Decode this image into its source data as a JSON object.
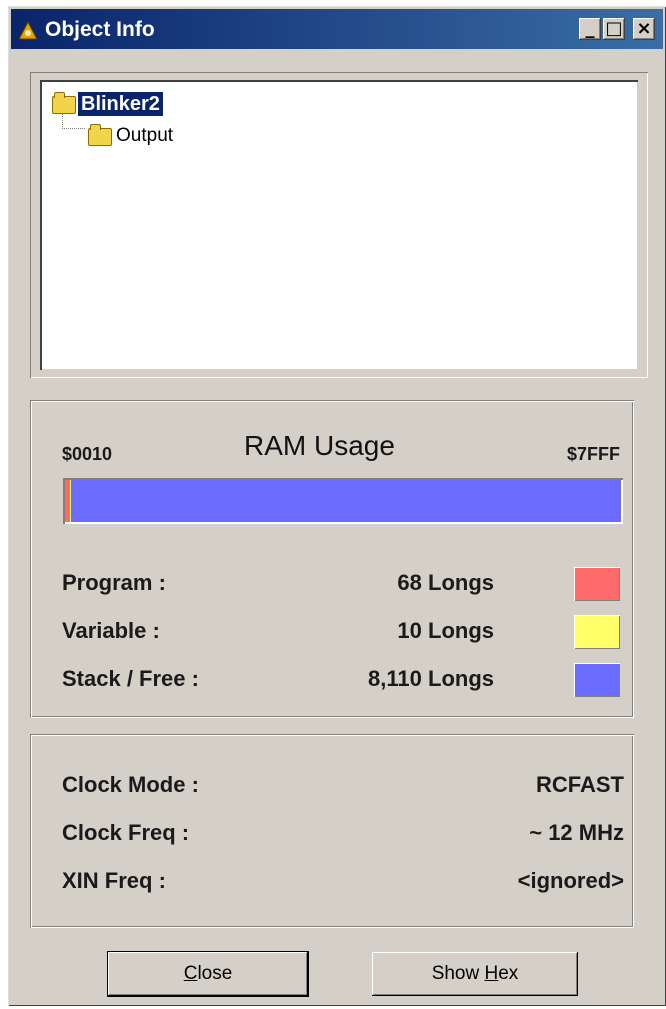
{
  "window": {
    "title": "Object Info",
    "controls": {
      "minimize": "_",
      "maximize": "□",
      "close": "×"
    }
  },
  "tree": {
    "root": "Blinker2",
    "child": "Output"
  },
  "ram": {
    "title": "RAM Usage",
    "start_addr": "$0010",
    "end_addr": "$7FFF",
    "rows": [
      {
        "label": "Program :",
        "value": "68 Longs",
        "color": "#ff6b6b"
      },
      {
        "label": "Variable :",
        "value": "10 Longs",
        "color": "#ffff66"
      },
      {
        "label": "Stack / Free :",
        "value": "8,110 Longs",
        "color": "#6b6bff"
      }
    ],
    "usage_longs": {
      "program": 68,
      "variable": 10,
      "stack_free": 8110
    }
  },
  "clock": {
    "rows": [
      {
        "label": "Clock Mode :",
        "value": "RCFAST"
      },
      {
        "label": "Clock Freq :",
        "value": "~ 12 MHz"
      },
      {
        "label": "XIN Freq :",
        "value": "<ignored>"
      }
    ]
  },
  "buttons": {
    "close": {
      "pre": "",
      "accel": "C",
      "post": "lose"
    },
    "show_hex": {
      "pre": "Show ",
      "accel": "H",
      "post": "ex"
    }
  }
}
